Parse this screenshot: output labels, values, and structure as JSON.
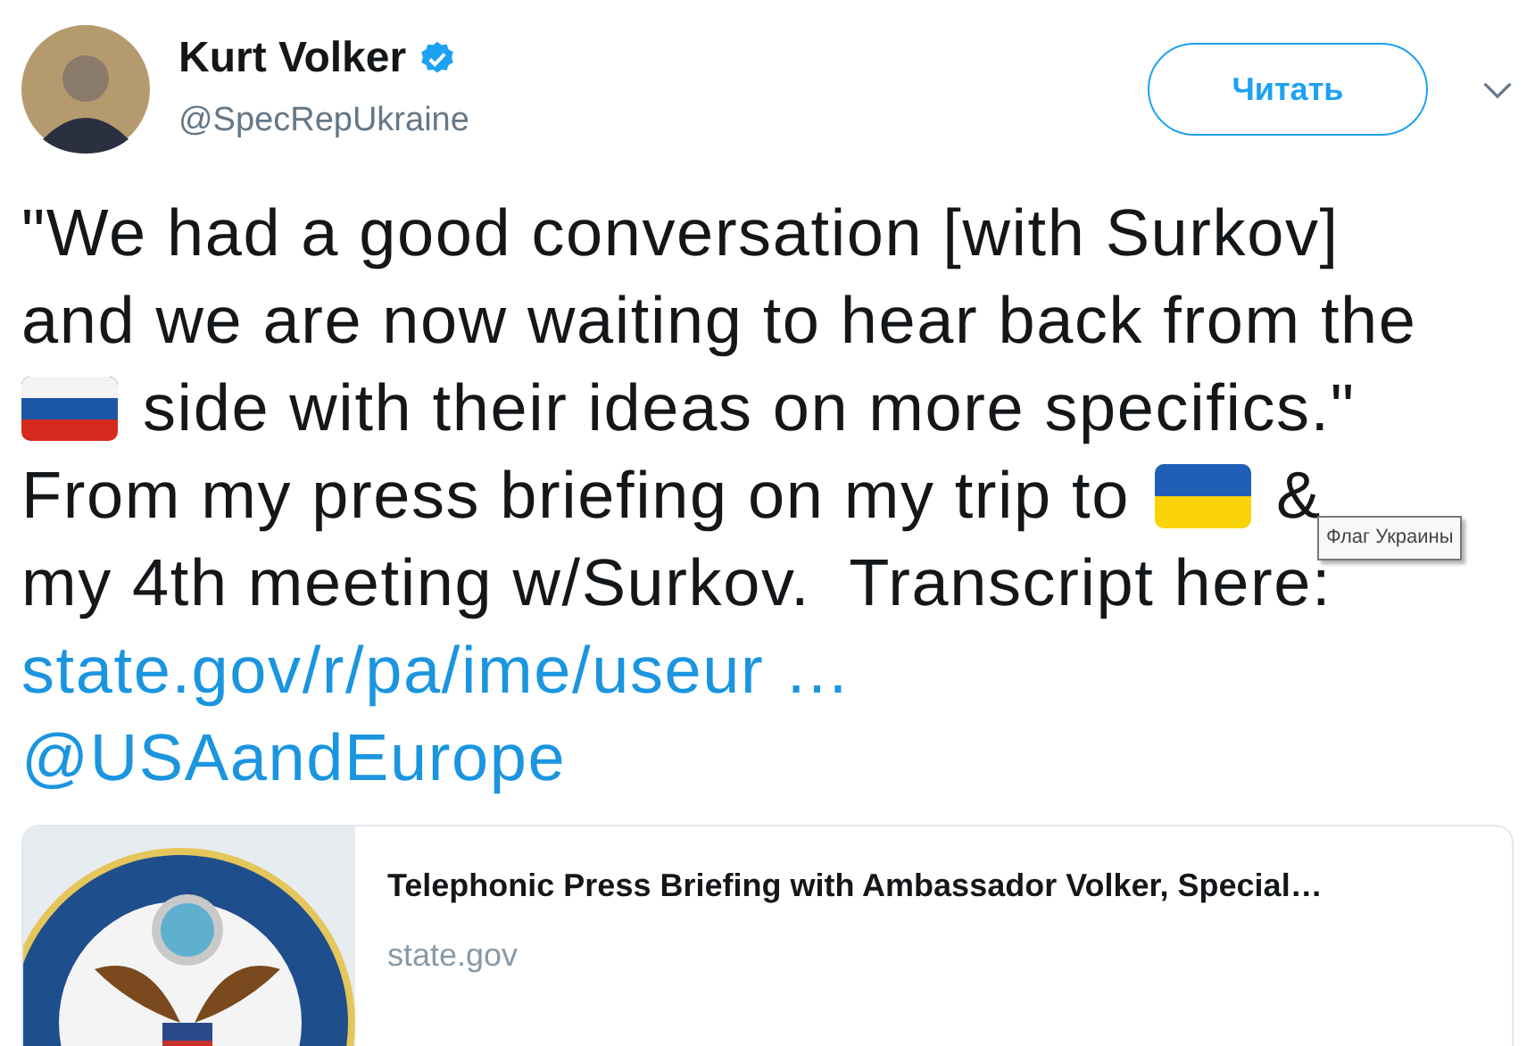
{
  "author": {
    "name": "Kurt Volker",
    "verified": true,
    "handle": "@SpecRepUkraine"
  },
  "follow_button": {
    "label": "Читать"
  },
  "tweet_lines": [
    [
      {
        "kind": "text",
        "text": "\"We had a good conversation [with Surkov]"
      }
    ],
    [
      {
        "kind": "text",
        "text": "and we are now waiting to hear back from the"
      }
    ],
    [
      {
        "kind": "russian_flag"
      },
      {
        "kind": "text",
        "text": "side with their ideas on more specifics.\""
      }
    ],
    [
      {
        "kind": "text",
        "text": "From my press briefing on my trip to"
      },
      {
        "kind": "ukrainian_flag"
      },
      {
        "kind": "text",
        "text": "&"
      }
    ],
    [
      {
        "kind": "text",
        "text": "my 4th meeting w/Surkov.  Transcript here:"
      }
    ],
    [
      {
        "kind": "link",
        "text": "state.gov/r/pa/ime/useur …"
      }
    ],
    [
      {
        "kind": "link",
        "text": "@USAandEurope"
      }
    ]
  ],
  "tooltip": {
    "text": "Флаг Украины"
  },
  "link_card": {
    "title": "Telephonic Press Briefing with Ambassador Volker, Special…",
    "domain": "state.gov"
  }
}
